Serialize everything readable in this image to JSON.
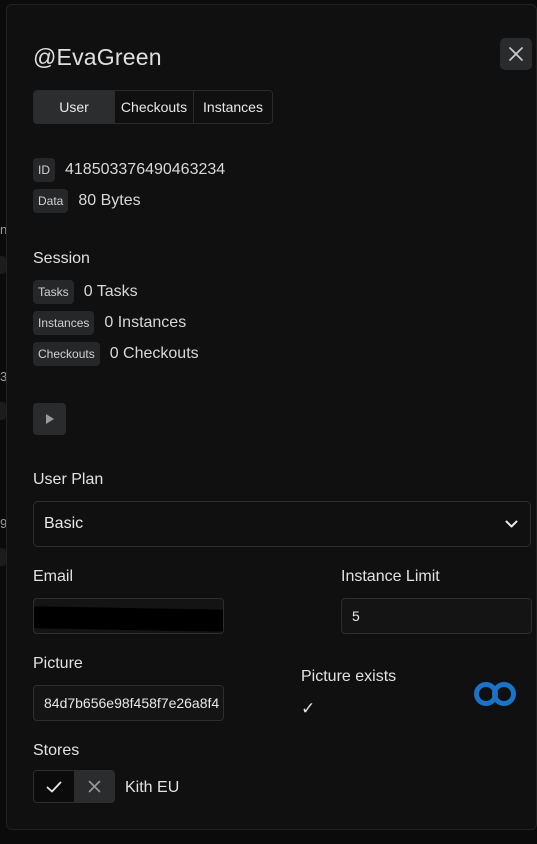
{
  "background": {
    "fragments": [
      "n",
      "e",
      "3",
      "e",
      "9",
      "e"
    ]
  },
  "modal": {
    "title": "@EvaGreen",
    "tabs": [
      {
        "label": "User",
        "active": true
      },
      {
        "label": "Checkouts",
        "active": false
      },
      {
        "label": "Instances",
        "active": false
      }
    ],
    "info": {
      "id_label": "ID",
      "id_value": "418503376490463234",
      "data_label": "Data",
      "data_value": "80 Bytes"
    },
    "session": {
      "heading": "Session",
      "tasks_label": "Tasks",
      "tasks_value": "0 Tasks",
      "instances_label": "Instances",
      "instances_value": "0 Instances",
      "checkouts_label": "Checkouts",
      "checkouts_value": "0 Checkouts"
    },
    "user_plan": {
      "label": "User Plan",
      "selected": "Basic"
    },
    "email": {
      "label": "Email",
      "value": ""
    },
    "instance_limit": {
      "label": "Instance Limit",
      "value": "5"
    },
    "picture": {
      "label": "Picture",
      "value": "84d7b656e98f458f7e26a8f4",
      "exists_label": "Picture exists",
      "exists_check": "✓"
    },
    "stores": {
      "label": "Stores",
      "store_name": "Kith EU"
    },
    "colors": {
      "panel_bg": "#0f100f",
      "accent_logo": "#1a73c8",
      "badge_bg": "#262728"
    }
  }
}
